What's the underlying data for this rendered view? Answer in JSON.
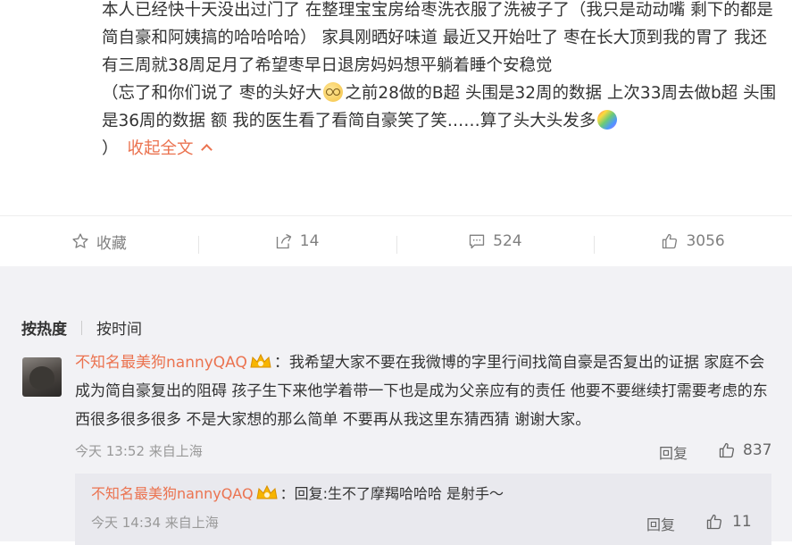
{
  "post": {
    "paragraph1": "本人已经快十天没出过门了 在整理宝宝房给枣洗衣服了洗被子了（我只是动动嘴 剩下的都是简自豪和阿姨搞的哈哈哈哈） 家具刚晒好味道 最近又开始吐了 枣在长大顶到我的胃了 我还有三周就38周足月了希望枣早日退房妈妈想平躺着睡个安稳觉",
    "paragraph2_part1": "（忘了和你们说了 枣的头好大",
    "paragraph2_part2": "之前28做的B超 头围是32周的数据 上次33周去做b超 头围是36周的数据 额 我的医生看了看简自豪笑了笑……算了头大头发多",
    "paragraph2_part3": "）",
    "collapse_label": "收起全文",
    "emoji1": "dizzy-face-emoji",
    "emoji2": "rainbow-emoji"
  },
  "actions": {
    "favorite_label": "收藏",
    "repost_count": "14",
    "comment_count": "524",
    "like_count": "3056"
  },
  "comments": {
    "sort_hot": "按热度",
    "sort_time": "按时间",
    "top_comment": {
      "username": "不知名最美狗nannyQAQ",
      "text": "：我希望大家不要在我微博的字里行间找简自豪是否复出的证据 家庭不会成为简自豪复出的阻碍 孩子生下来他学着带一下也是成为父亲应有的责任 他要不要继续打需要考虑的东西很多很多很多 不是大家想的那么简单 不要再从我这里东猜西猜 谢谢大家。",
      "time": "今天 13:52 来自上海",
      "reply_label": "回复",
      "likes": "837"
    },
    "sub_reply": {
      "username": "不知名最美狗nannyQAQ",
      "text": "：回复:生不了摩羯哈哈哈 是射手～",
      "time": "今天 14:34 来自上海",
      "reply_label": "回复",
      "likes": "11"
    }
  },
  "colors": {
    "accent": "#eb7350",
    "muted": "#808080",
    "comment_bg": "#f2f2f5",
    "subreply_bg": "#e9e9ee"
  }
}
